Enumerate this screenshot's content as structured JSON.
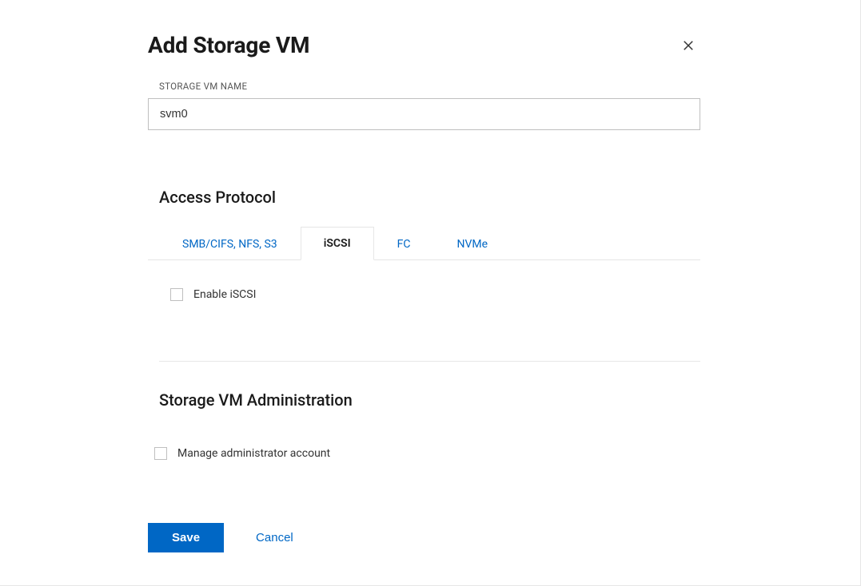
{
  "header": {
    "title": "Add Storage VM"
  },
  "name_field": {
    "label": "STORAGE VM NAME",
    "value": "svm0"
  },
  "access_protocol": {
    "section_label": "Access Protocol",
    "tabs": [
      {
        "label": "SMB/CIFS, NFS, S3"
      },
      {
        "label": "iSCSI"
      },
      {
        "label": "FC"
      },
      {
        "label": "NVMe"
      }
    ],
    "enable_iscsi_label": "Enable iSCSI"
  },
  "administration": {
    "section_label": "Storage VM Administration",
    "manage_admin_label": "Manage administrator account"
  },
  "actions": {
    "save": "Save",
    "cancel": "Cancel"
  }
}
